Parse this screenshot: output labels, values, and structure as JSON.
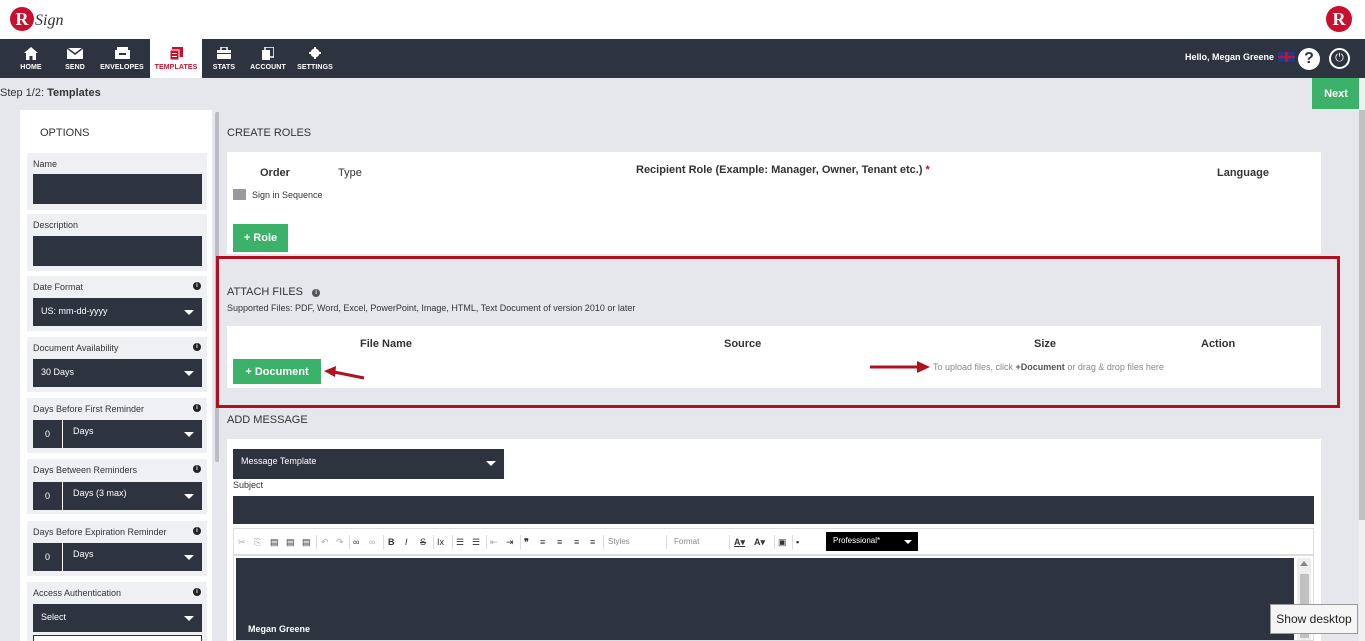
{
  "brand": {
    "logo_letter": "R",
    "logo_text": "Sign",
    "logo_right_letter": "R"
  },
  "nav": {
    "items": [
      {
        "label": "HOME",
        "icon": "home-icon"
      },
      {
        "label": "SEND",
        "icon": "envelope-icon"
      },
      {
        "label": "ENVELOPES",
        "icon": "inbox-icon"
      },
      {
        "label": "TEMPLATES",
        "icon": "templates-icon",
        "active": true
      },
      {
        "label": "STATS",
        "icon": "briefcase-icon"
      },
      {
        "label": "ACCOUNT",
        "icon": "document-icon"
      },
      {
        "label": "SETTINGS",
        "icon": "gear-icon"
      }
    ],
    "greeting": "Hello, Megan Greene",
    "help_label": "?",
    "power_label": "⏻"
  },
  "step": {
    "prefix": "Step 1/2: ",
    "title": "Templates",
    "next_label": "Next"
  },
  "options": {
    "title": "OPTIONS",
    "name_label": "Name",
    "description_label": "Description",
    "date_format_label": "Date Format",
    "date_format_value": "US: mm-dd-yyyy",
    "doc_availability_label": "Document Availability",
    "doc_availability_value": "30 Days",
    "first_reminder_label": "Days Before First Reminder",
    "first_reminder_num": "0",
    "first_reminder_value": "Days",
    "between_reminders_label": "Days Between Reminders",
    "between_reminders_num": "0",
    "between_reminders_value": "Days (3 max)",
    "expiration_label": "Days Before Expiration Reminder",
    "expiration_num": "0",
    "expiration_value": "Days",
    "access_auth_label": "Access Authentication",
    "access_auth_value": "Select"
  },
  "roles": {
    "section_title": "CREATE ROLES",
    "col_order": "Order",
    "col_type": "Type",
    "col_recipient": "Recipient Role (Example: Manager, Owner, Tenant etc.)",
    "required_mark": "*",
    "col_language": "Language",
    "sign_in_sequence": "Sign in Sequence",
    "add_role_label": "+ Role"
  },
  "attach": {
    "section_title": "ATTACH FILES",
    "supported": "Supported Files: PDF, Word, Excel, PowerPoint, Image, HTML, Text Document of version 2010 or later",
    "col_file_name": "File Name",
    "col_source": "Source",
    "col_size": "Size",
    "col_action": "Action",
    "add_document_label": "+ Document",
    "upload_hint_pre": "To upload files, click ",
    "upload_hint_bold": "+Document",
    "upload_hint_post": " or drag & drop files here"
  },
  "message": {
    "section_title": "ADD MESSAGE",
    "template_value": "Message Template",
    "subject_label": "Subject",
    "styles_label": "Styles",
    "format_label": "Format",
    "font_value": "Professional*",
    "signature_name": "Megan Greene"
  },
  "system": {
    "show_desktop": "Show desktop"
  },
  "colors": {
    "brand_red": "#c8102e",
    "nav_dark": "#2d3440",
    "green": "#3cb16a",
    "highlight": "#b01020"
  }
}
